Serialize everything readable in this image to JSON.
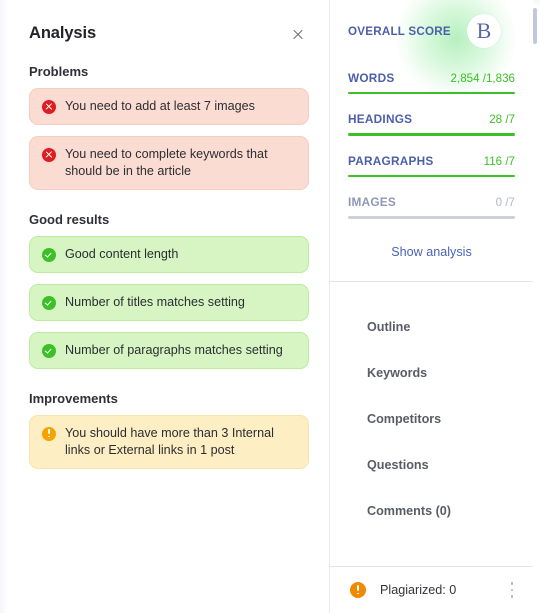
{
  "left_panel": {
    "title": "Analysis",
    "close_icon": "close-icon",
    "sections": [
      {
        "label": "Problems",
        "type": "error",
        "items": [
          {
            "icon": "error-circle-icon",
            "text": "You need to add at least 7 images"
          },
          {
            "icon": "error-circle-icon",
            "text": "You need to complete keywords that should be in the article"
          }
        ]
      },
      {
        "label": "Good results",
        "type": "success",
        "items": [
          {
            "icon": "check-circle-icon",
            "text": "Good content length"
          },
          {
            "icon": "check-circle-icon",
            "text": "Number of titles matches setting"
          },
          {
            "icon": "check-circle-icon",
            "text": "Number of paragraphs matches setting"
          }
        ]
      },
      {
        "label": "Improvements",
        "type": "warn",
        "items": [
          {
            "icon": "warning-circle-icon",
            "text": "You should have more than 3 Internal links or External links in 1 post"
          }
        ]
      }
    ]
  },
  "right_panel": {
    "overall_score_label": "OVERALL SCORE",
    "overall_score_grade": "B",
    "metrics": [
      {
        "name": "WORDS",
        "value": "2,854 /1,836",
        "state": "good"
      },
      {
        "name": "HEADINGS",
        "value": "28 /7",
        "state": "good"
      },
      {
        "name": "PARAGRAPHS",
        "value": "116 /7",
        "state": "good"
      },
      {
        "name": "IMAGES",
        "value": "0 /7",
        "state": "empty"
      }
    ],
    "show_analysis_label": "Show analysis",
    "nav_items": [
      {
        "label": "Outline"
      },
      {
        "label": "Keywords"
      },
      {
        "label": "Competitors"
      },
      {
        "label": "Questions"
      },
      {
        "label": "Comments (0)"
      }
    ],
    "footer": {
      "icon": "warning-circle-icon",
      "plagiarized_label": "Plagiarized: 0",
      "menu_icon": "kebab-menu-icon"
    }
  },
  "colors": {
    "accent_blue": "#4c5fa8",
    "success_green": "#3cbf27",
    "error_red": "#e01b22",
    "warn_orange": "#f5a300",
    "link_blue": "#4a63b5"
  }
}
